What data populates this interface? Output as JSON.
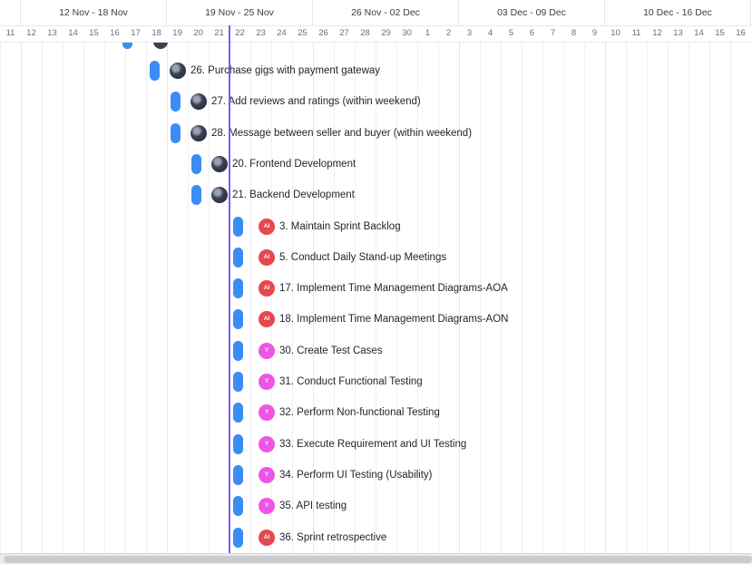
{
  "timeline": {
    "weeks": [
      {
        "label": "12 Nov - 18 Nov"
      },
      {
        "label": "19 Nov - 25 Nov"
      },
      {
        "label": "26 Nov - 02 Dec"
      },
      {
        "label": "03 Dec - 09 Dec"
      },
      {
        "label": "10 Dec - 16 Dec"
      }
    ],
    "days": [
      "11",
      "12",
      "13",
      "14",
      "15",
      "16",
      "17",
      "18",
      "19",
      "20",
      "21",
      "22",
      "23",
      "24",
      "25",
      "26",
      "27",
      "28",
      "29",
      "30",
      "1",
      "2",
      "3",
      "4",
      "5",
      "6",
      "7",
      "8",
      "9",
      "10",
      "11",
      "12",
      "13",
      "14",
      "15",
      "16"
    ],
    "today_color": "#7b5cf0"
  },
  "colors": {
    "bar": "#3b8cf5",
    "avatar_ai": "#e5484d",
    "avatar_y": "#ee55e6"
  },
  "tasks": [
    {
      "name": "26. Purchase gigs with payment gateway",
      "avatar": "photo",
      "avatar_text": ""
    },
    {
      "name": "27. Add reviews and ratings (within weekend)",
      "avatar": "photo",
      "avatar_text": ""
    },
    {
      "name": "28. Message between seller and buyer (within weekend)",
      "avatar": "photo",
      "avatar_text": ""
    },
    {
      "name": "20. Frontend Development",
      "avatar": "photo",
      "avatar_text": ""
    },
    {
      "name": "21. Backend Development",
      "avatar": "photo",
      "avatar_text": ""
    },
    {
      "name": "3. Maintain Sprint Backlog",
      "avatar": "ai",
      "avatar_text": "AI"
    },
    {
      "name": "5. Conduct Daily Stand-up Meetings",
      "avatar": "ai",
      "avatar_text": "AI"
    },
    {
      "name": "17. Implement Time Management Diagrams-AOA",
      "avatar": "ai",
      "avatar_text": "AI"
    },
    {
      "name": "18. Implement Time Management Diagrams-AON",
      "avatar": "ai",
      "avatar_text": "AI"
    },
    {
      "name": "30. Create Test Cases",
      "avatar": "y",
      "avatar_text": "Y"
    },
    {
      "name": "31. Conduct Functional Testing",
      "avatar": "y",
      "avatar_text": "Y"
    },
    {
      "name": "32. Perform Non-functional Testing",
      "avatar": "y",
      "avatar_text": "Y"
    },
    {
      "name": "33. Execute Requirement and UI Testing",
      "avatar": "y",
      "avatar_text": "Y"
    },
    {
      "name": "34. Perform UI Testing (Usability)",
      "avatar": "y",
      "avatar_text": "Y"
    },
    {
      "name": "35. API testing",
      "avatar": "y",
      "avatar_text": "Y"
    },
    {
      "name": "36. Sprint retrospective",
      "avatar": "ai",
      "avatar_text": "AI"
    }
  ]
}
